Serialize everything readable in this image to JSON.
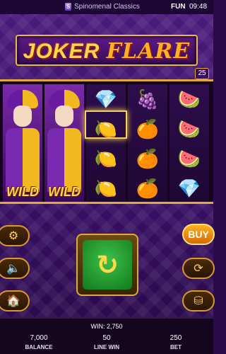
{
  "topbar": {
    "provider": "Spinomenal Classics",
    "provider_logo": "S",
    "mode": "FUN",
    "time": "09:48"
  },
  "logo": {
    "word1": "JOKER",
    "word2": "FLARE"
  },
  "lines": "25",
  "reels": [
    {
      "type": "wild",
      "label": "WILD"
    },
    {
      "type": "wild",
      "label": "WILD"
    },
    {
      "type": "symbols",
      "symbols": [
        {
          "icon": "diamond-icon",
          "glyph": "💎"
        },
        {
          "icon": "lemon-icon",
          "glyph": "🍋"
        },
        {
          "icon": "lemon-icon",
          "glyph": "🍋"
        },
        {
          "icon": "lemon-icon",
          "glyph": "🍋"
        }
      ]
    },
    {
      "type": "symbols",
      "symbols": [
        {
          "icon": "grapes-icon",
          "glyph": "🍇"
        },
        {
          "icon": "orange-icon",
          "glyph": "🍊"
        },
        {
          "icon": "orange-icon",
          "glyph": "🍊"
        },
        {
          "icon": "orange-icon",
          "glyph": "🍊"
        }
      ]
    },
    {
      "type": "symbols",
      "symbols": [
        {
          "icon": "watermelon-icon",
          "glyph": "🍉"
        },
        {
          "icon": "watermelon-icon",
          "glyph": "🍉"
        },
        {
          "icon": "watermelon-icon",
          "glyph": "🍉"
        },
        {
          "icon": "diamond-icon",
          "glyph": "💎"
        }
      ]
    }
  ],
  "buttons": {
    "settings": "⚙",
    "sound": "🔈",
    "home": "🏠",
    "buy": "BUY",
    "autoplay": "⟳",
    "bet": "⛁",
    "spin": "↻"
  },
  "info": {
    "win_label": "WIN:",
    "win_value": "2,750",
    "balance_value": "7,000",
    "balance_label": "BALANCE",
    "linewin_value": "50",
    "linewin_label": "LINE WIN",
    "bet_value": "250",
    "bet_label": "BET"
  },
  "colors": {
    "gold": "#e0a93a",
    "purple": "#3a0f66",
    "spin_green": "#2aa838"
  }
}
